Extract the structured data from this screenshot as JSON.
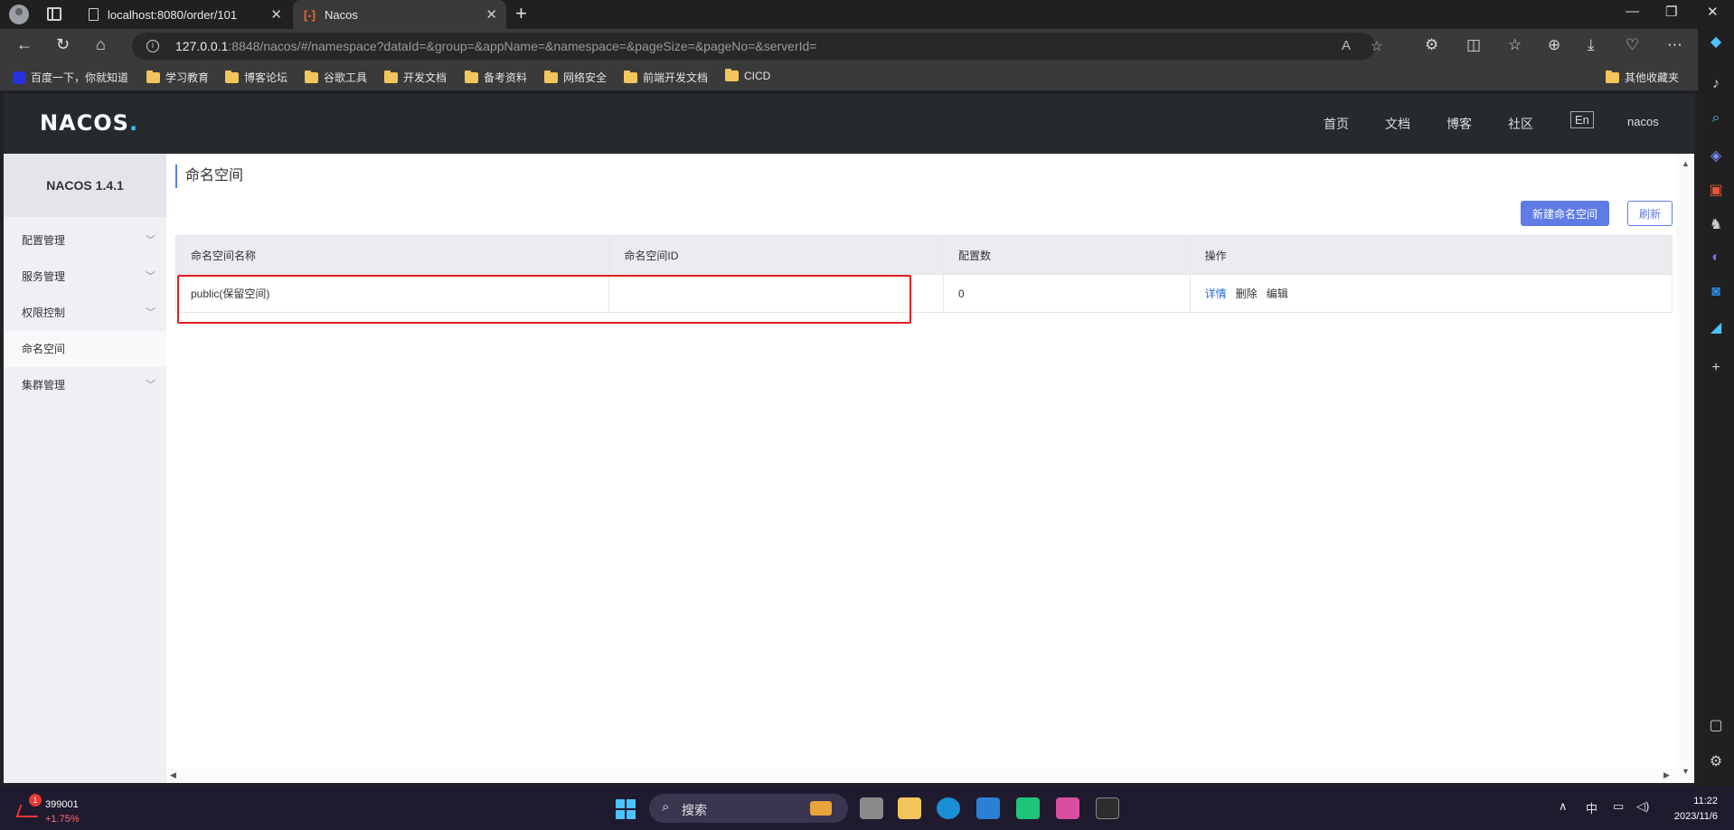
{
  "browser": {
    "tabs": [
      {
        "title": "localhost:8080/order/101"
      },
      {
        "title": "Nacos",
        "favicon": "[-]"
      }
    ],
    "url_host": "127.0.0.1",
    "url_rest": ":8848/nacos/#/namespace?dataId=&group=&appName=&namespace=&pageSize=&pageNo=&serverId=",
    "bookmarks": [
      "百度一下，你就知道",
      "学习教育",
      "博客论坛",
      "谷歌工具",
      "开发文档",
      "备考资料",
      "网络安全",
      "前端开发文档",
      "CICD"
    ],
    "other_bookmarks": "其他收藏夹"
  },
  "nacos": {
    "logo": "NACOS",
    "header_nav": [
      "首页",
      "文档",
      "博客",
      "社区"
    ],
    "lang": "En",
    "user": "nacos",
    "version": "NACOS 1.4.1",
    "sidebar": [
      {
        "label": "配置管理",
        "expandable": true
      },
      {
        "label": "服务管理",
        "expandable": true
      },
      {
        "label": "权限控制",
        "expandable": true
      },
      {
        "label": "命名空间",
        "expandable": false,
        "active": true
      },
      {
        "label": "集群管理",
        "expandable": true
      }
    ],
    "page_title": "命名空间",
    "buttons": {
      "create": "新建命名空间",
      "refresh": "刷新"
    },
    "table": {
      "headers": [
        "命名空间名称",
        "命名空间ID",
        "配置数",
        "操作"
      ],
      "rows": [
        {
          "name": "public(保留空间)",
          "id": "",
          "count": "0",
          "ops": [
            "详情",
            "删除",
            "编辑"
          ]
        }
      ]
    }
  },
  "taskbar": {
    "stock_badge": "1",
    "stock_value": "399001",
    "stock_change": "+1.75%",
    "search_label": "搜索",
    "ime": "中",
    "time": "11:22",
    "date": "2023/11/6"
  }
}
